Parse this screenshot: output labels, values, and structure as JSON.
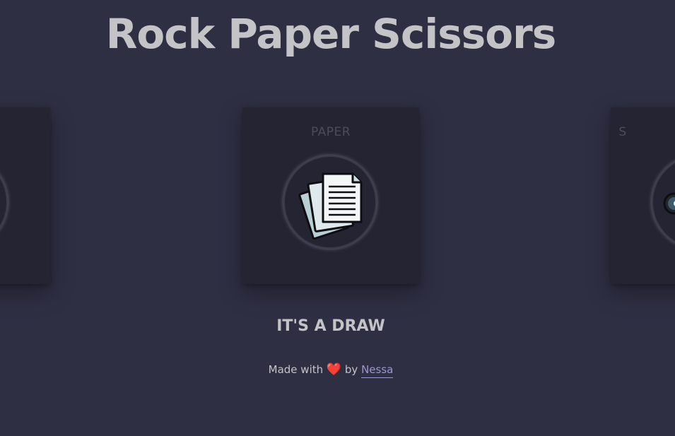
{
  "header": {
    "title": "Rock Paper Scissors"
  },
  "cards": {
    "left": {
      "label": "",
      "icon": "rock-icon"
    },
    "center": {
      "label": "PAPER",
      "icon": "paper-icon"
    },
    "right": {
      "label": "S",
      "icon": "scissors-icon"
    }
  },
  "result": {
    "text": "IT'S A DRAW"
  },
  "footer": {
    "made_with": "Made with",
    "heart": "❤️",
    "by": "by",
    "author": "Nessa"
  },
  "colors": {
    "background": "#2f2f44",
    "card": "#242433",
    "text": "#c4c3c6",
    "link": "#9d97d0",
    "heart": "#e0262b"
  }
}
